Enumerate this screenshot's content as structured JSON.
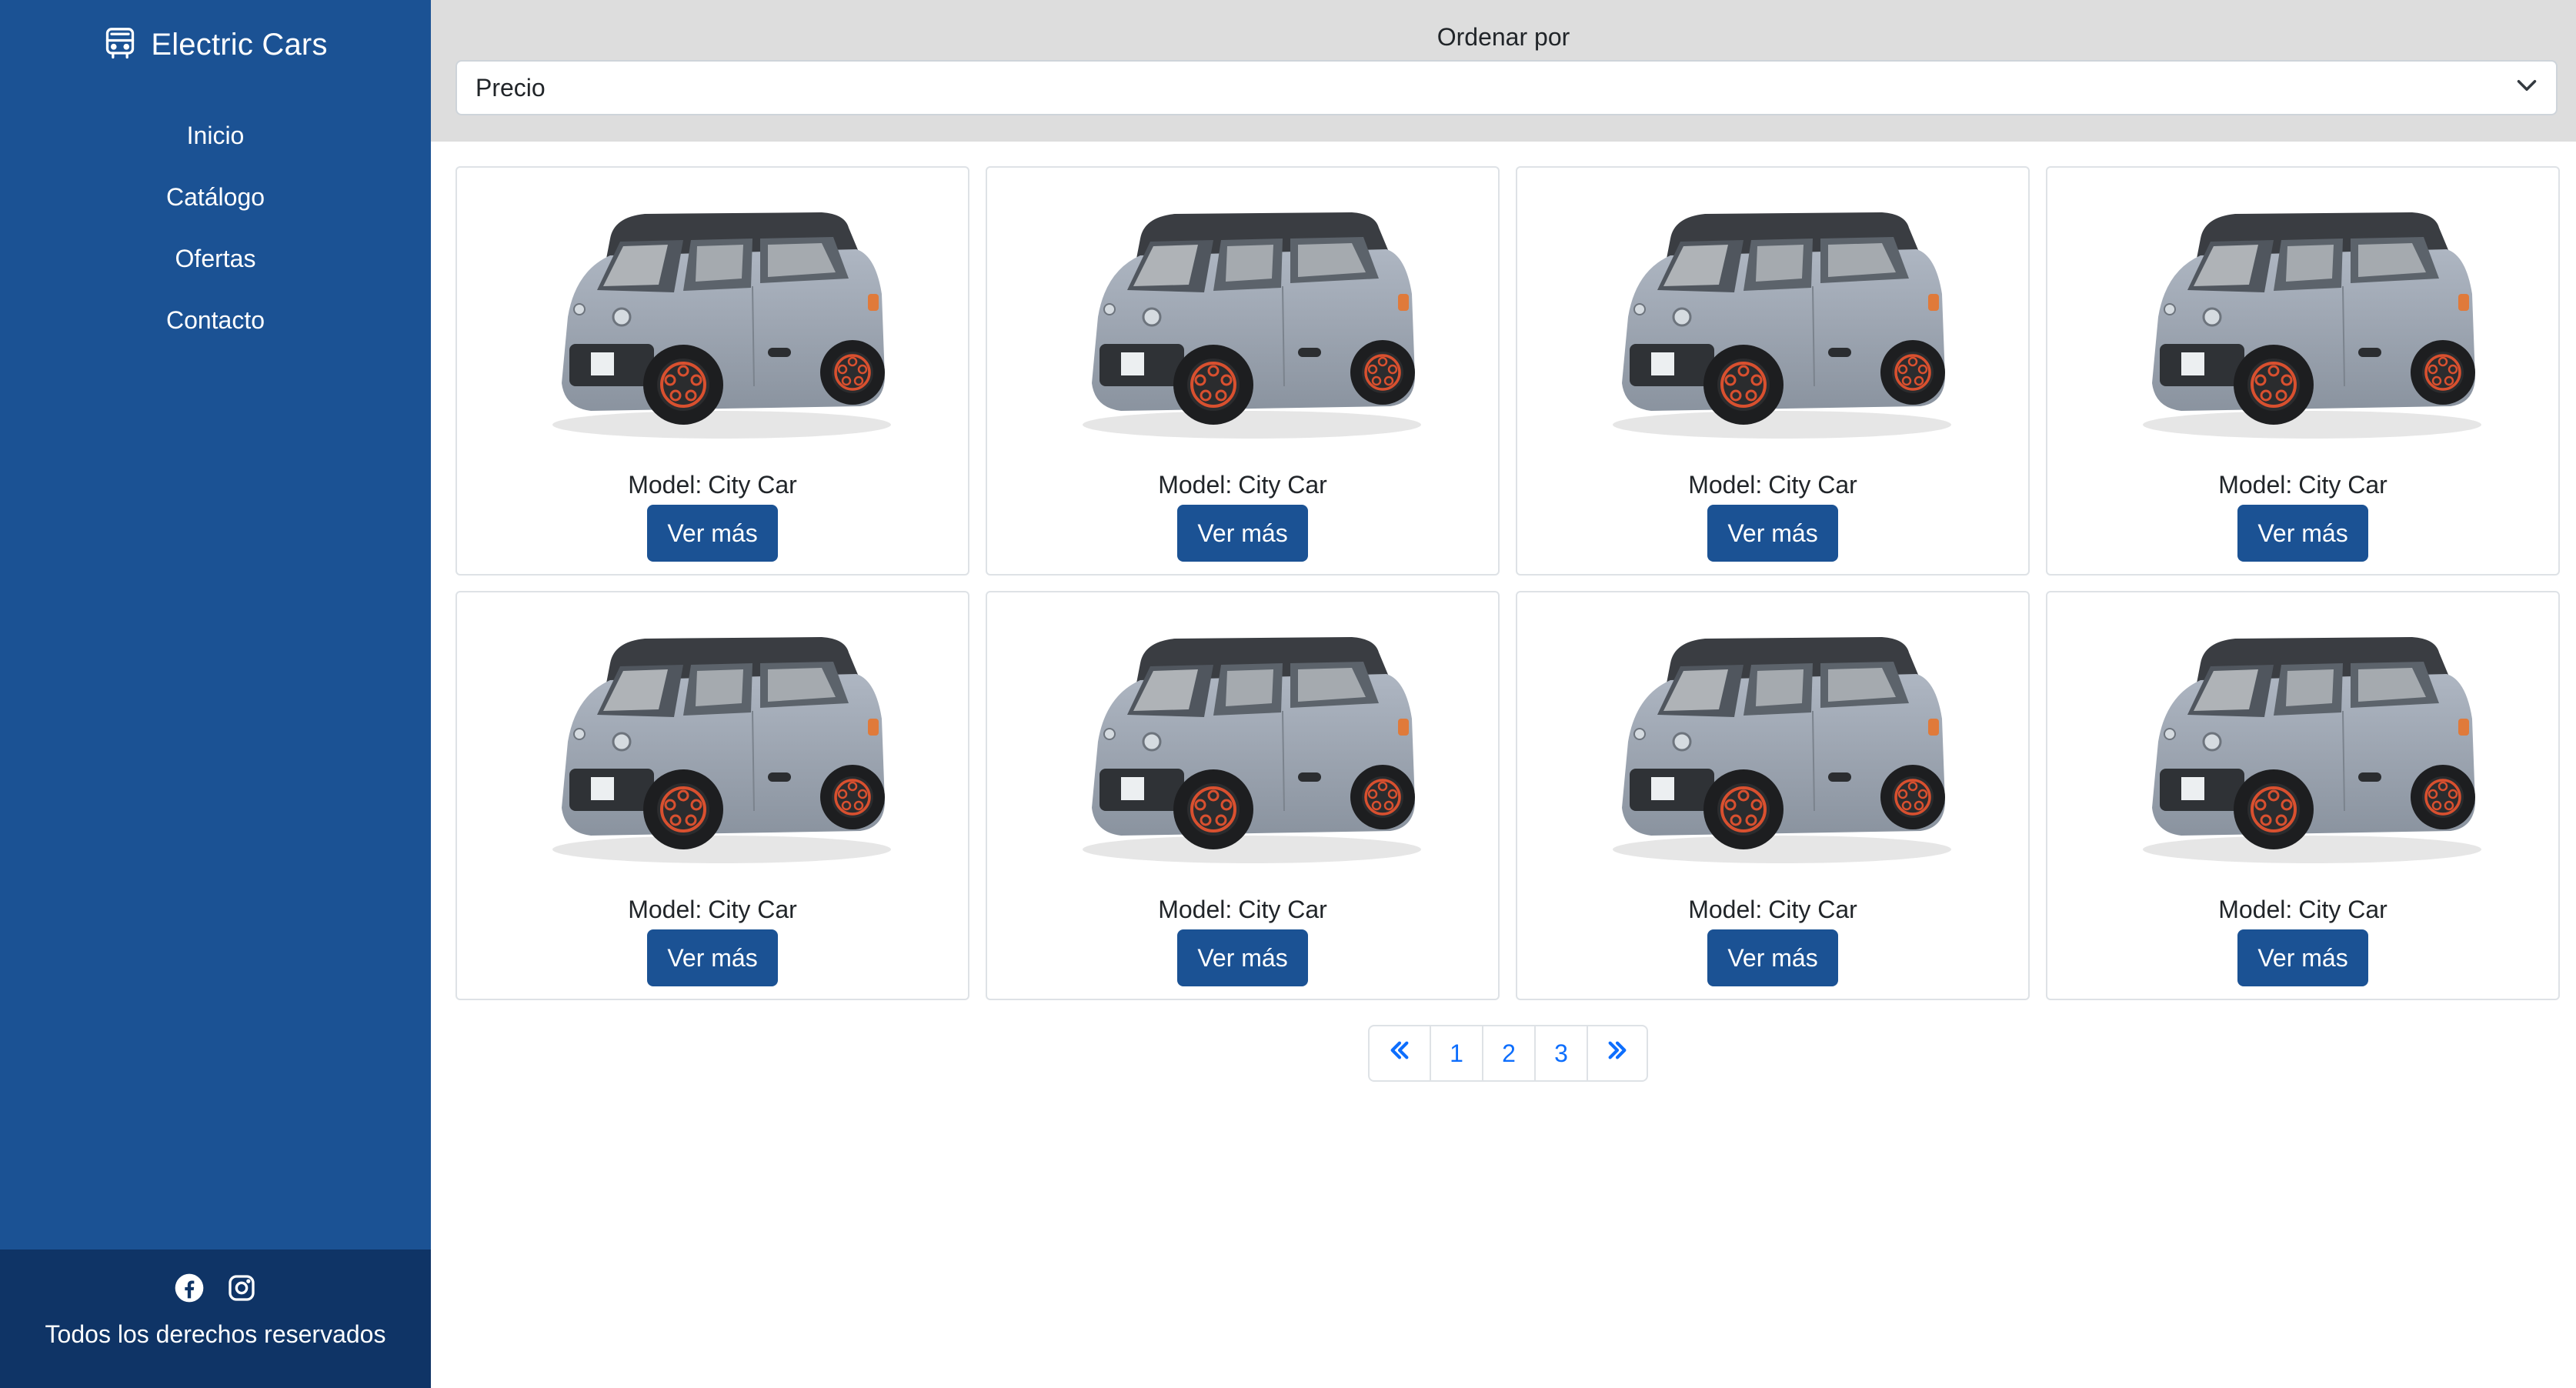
{
  "sidebar": {
    "brand": "Electric Cars",
    "brand_icon": "bus-icon",
    "nav": [
      {
        "label": "Inicio"
      },
      {
        "label": "Catálogo"
      },
      {
        "label": "Ofertas"
      },
      {
        "label": "Contacto"
      }
    ],
    "social_icons": [
      "facebook-icon",
      "instagram-icon"
    ],
    "copyright": "Todos los derechos reservados"
  },
  "sort": {
    "label": "Ordenar por",
    "selected": "Precio"
  },
  "cards": [
    {
      "model_prefix": "Model:",
      "model": "City Car",
      "button": "Ver más"
    },
    {
      "model_prefix": "Model:",
      "model": "City Car",
      "button": "Ver más"
    },
    {
      "model_prefix": "Model:",
      "model": "City Car",
      "button": "Ver más"
    },
    {
      "model_prefix": "Model:",
      "model": "City Car",
      "button": "Ver más"
    },
    {
      "model_prefix": "Model:",
      "model": "City Car",
      "button": "Ver más"
    },
    {
      "model_prefix": "Model:",
      "model": "City Car",
      "button": "Ver más"
    },
    {
      "model_prefix": "Model:",
      "model": "City Car",
      "button": "Ver más"
    },
    {
      "model_prefix": "Model:",
      "model": "City Car",
      "button": "Ver más"
    }
  ],
  "pagination": {
    "first_icon": "double-chevron-left-icon",
    "pages": [
      "1",
      "2",
      "3"
    ],
    "last_icon": "double-chevron-right-icon"
  },
  "colors": {
    "sidebar": "#1b5294",
    "sidebar_footer": "#0f3466",
    "topbar": "#dddddd",
    "button": "#1b5294",
    "link": "#0d6efd"
  }
}
